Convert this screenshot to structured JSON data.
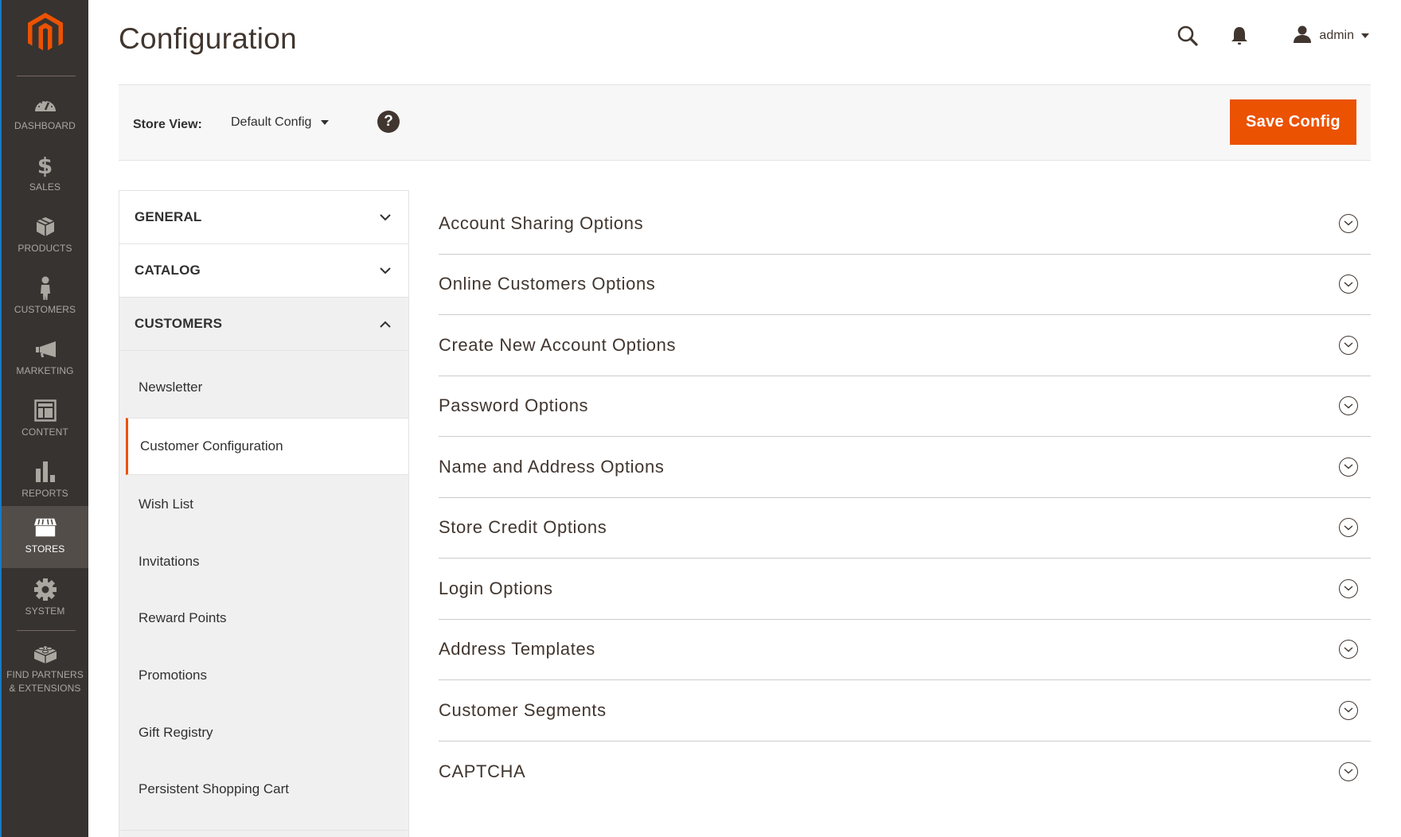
{
  "brand": {
    "accent": "#eb5202",
    "sidebar_bg": "#373330",
    "sidebar_active_bg": "#524d49"
  },
  "sidebar": {
    "logo": "magento-logo",
    "items": [
      {
        "label": "DASHBOARD",
        "icon": "dashboard-icon",
        "active": false
      },
      {
        "label": "SALES",
        "icon": "dollar-icon",
        "active": false
      },
      {
        "label": "PRODUCTS",
        "icon": "box-icon",
        "active": false
      },
      {
        "label": "CUSTOMERS",
        "icon": "person-icon",
        "active": false
      },
      {
        "label": "MARKETING",
        "icon": "megaphone-icon",
        "active": false
      },
      {
        "label": "CONTENT",
        "icon": "layout-icon",
        "active": false
      },
      {
        "label": "REPORTS",
        "icon": "bar-chart-icon",
        "active": false
      },
      {
        "label": "STORES",
        "icon": "storefront-icon",
        "active": true
      },
      {
        "label": "SYSTEM",
        "icon": "gear-icon",
        "active": false
      },
      {
        "label": "FIND PARTNERS",
        "label2": "& EXTENSIONS",
        "icon": "lego-brick-icon",
        "active": false
      }
    ]
  },
  "header": {
    "title": "Configuration",
    "user": "admin"
  },
  "store_bar": {
    "label": "Store View:",
    "selected": "Default Config",
    "help": "?",
    "save_label": "Save Config"
  },
  "tabs": {
    "groups": [
      {
        "label": "GENERAL",
        "expanded": false
      },
      {
        "label": "CATALOG",
        "expanded": false
      },
      {
        "label": "CUSTOMERS",
        "expanded": true
      }
    ],
    "customer_items": [
      {
        "label": "Newsletter",
        "active": false
      },
      {
        "label": "Customer Configuration",
        "active": true
      },
      {
        "label": "Wish List",
        "active": false
      },
      {
        "label": "Invitations",
        "active": false
      },
      {
        "label": "Reward Points",
        "active": false
      },
      {
        "label": "Promotions",
        "active": false
      },
      {
        "label": "Gift Registry",
        "active": false
      },
      {
        "label": "Persistent Shopping Cart",
        "active": false
      }
    ]
  },
  "sections": [
    {
      "title": "Account Sharing Options"
    },
    {
      "title": "Online Customers Options"
    },
    {
      "title": "Create New Account Options"
    },
    {
      "title": "Password Options"
    },
    {
      "title": "Name and Address Options"
    },
    {
      "title": "Store Credit Options"
    },
    {
      "title": "Login Options"
    },
    {
      "title": "Address Templates"
    },
    {
      "title": "Customer Segments"
    },
    {
      "title": "CAPTCHA"
    }
  ]
}
